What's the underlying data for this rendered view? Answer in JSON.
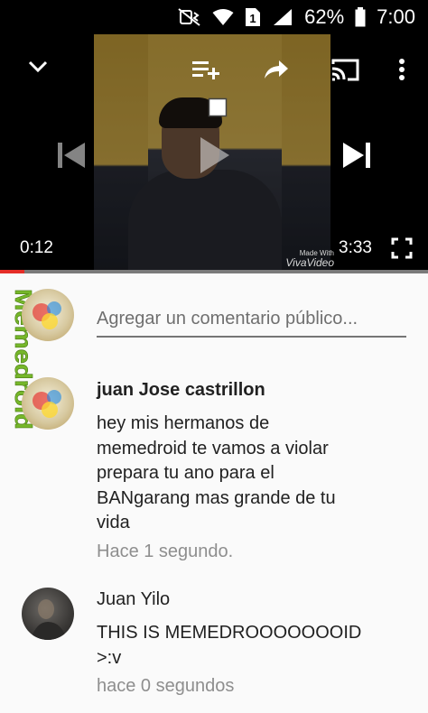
{
  "status_bar": {
    "battery_percent": "62%",
    "clock": "7:00",
    "sim_number": "1",
    "icons": [
      "mute-vibrate-icon",
      "wifi-icon",
      "sim-icon",
      "signal-icon",
      "battery-icon"
    ]
  },
  "player": {
    "icons": [
      "minimize-chevron-icon",
      "add-to-playlist-icon",
      "share-icon",
      "cast-icon",
      "more-vert-icon",
      "stop-icon",
      "previous-icon",
      "play-icon",
      "next-icon",
      "fullscreen-icon"
    ],
    "elapsed": "0:12",
    "duration": "3:33",
    "watermark_line1": "Made With",
    "watermark_line2": "VivaVideo",
    "progress_fraction": 0.056,
    "progress_color": "#e52d27"
  },
  "sidebar": {
    "logo_text": "Memedroid",
    "logo_color": "#76b72a"
  },
  "comment_box": {
    "placeholder": "Agregar un comentario público..."
  },
  "comments": [
    {
      "author": "juan Jose castrillon",
      "text_lines": [
        "hey mis hermanos de",
        "memedroid te vamos a violar",
        "prepara tu ano para el",
        "BANgarang mas grande de tu",
        "vida"
      ],
      "time": "Hace 1 segundo."
    },
    {
      "author": "Juan Yilo",
      "text_lines": [
        "THIS IS MEMEDROOOOOOOID",
        ">:v"
      ],
      "time": "hace 0 segundos"
    }
  ]
}
